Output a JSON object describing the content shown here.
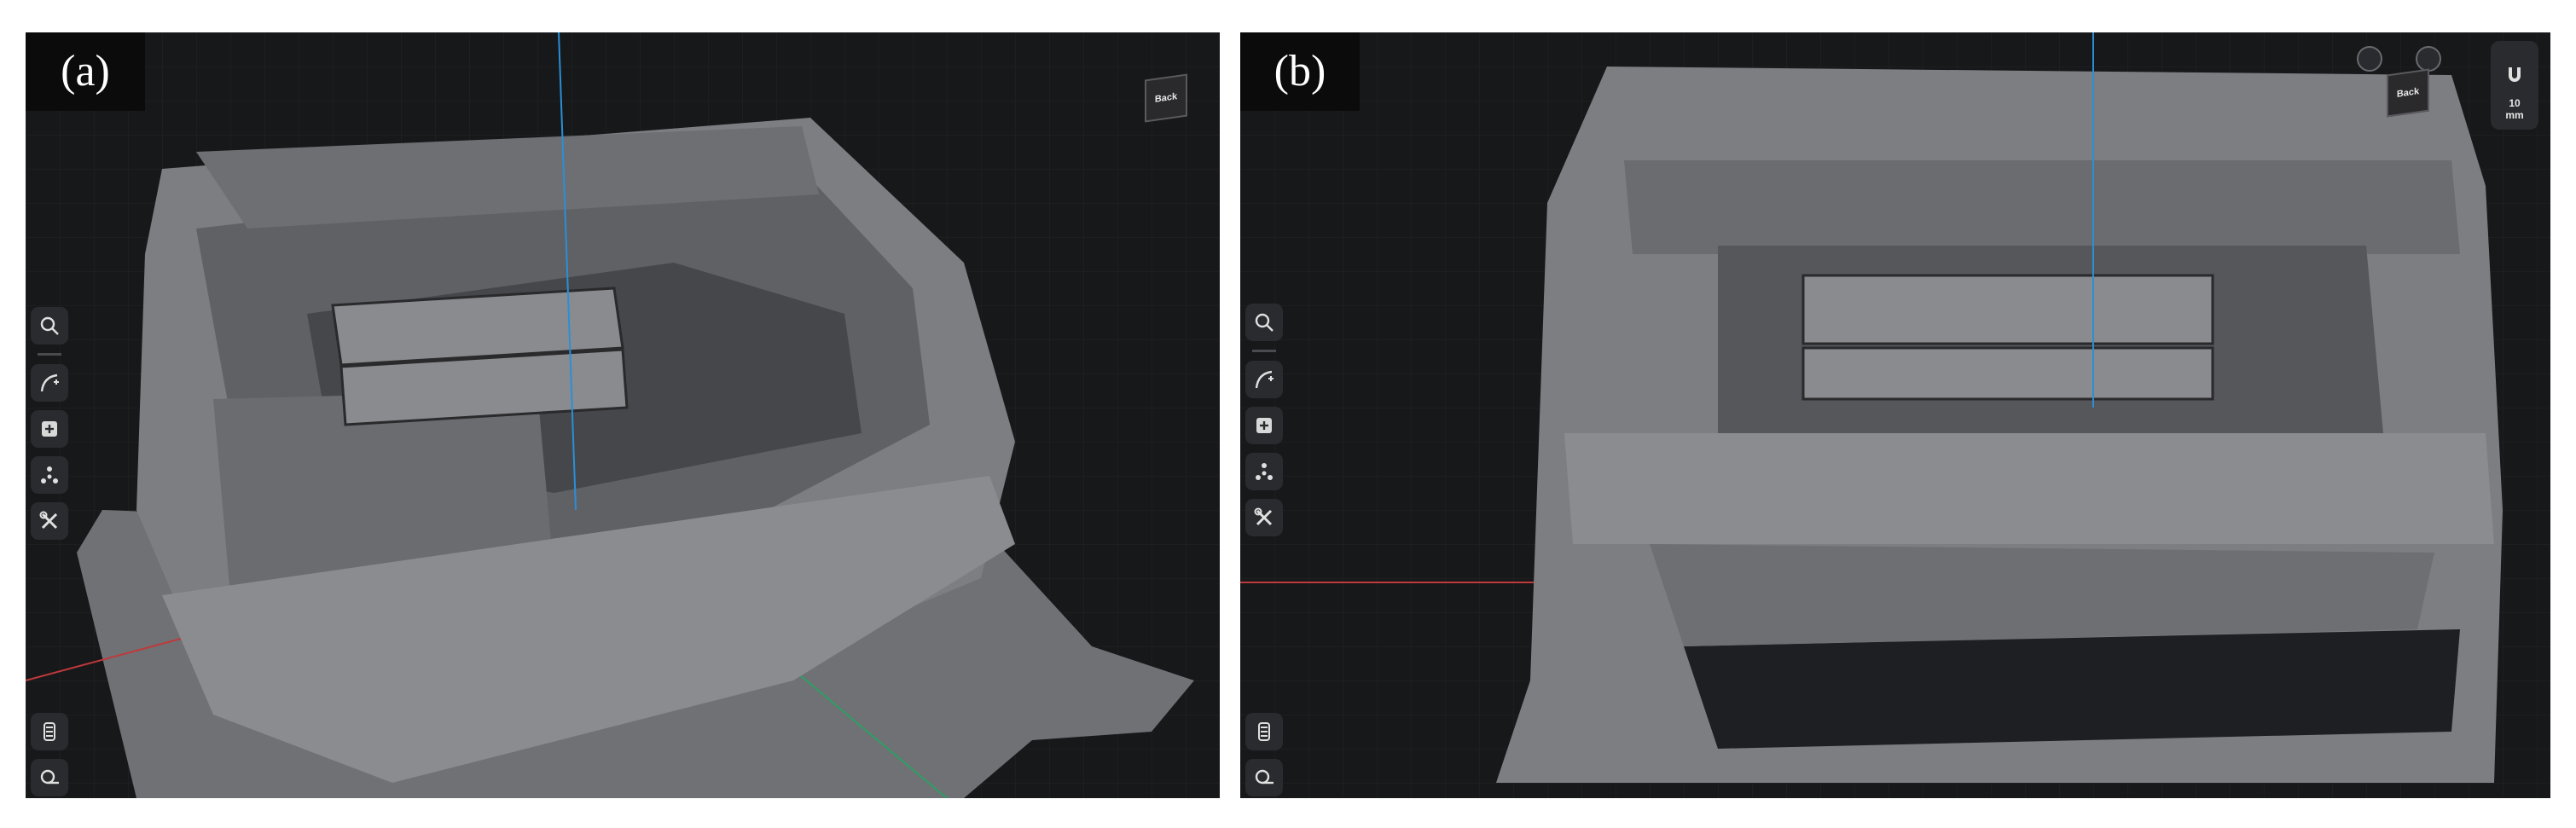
{
  "panels": [
    {
      "label": "(a)",
      "viewcube": {
        "face_label": "Back"
      },
      "toolbar": {
        "tools": [
          {
            "icon": "search-icon"
          },
          {
            "icon": "measure-curve-icon"
          },
          {
            "icon": "add-icon"
          },
          {
            "icon": "axis-gizmo-icon"
          },
          {
            "icon": "tools-icon"
          }
        ],
        "bottom": [
          {
            "icon": "layers-icon"
          },
          {
            "icon": "tape-measure-icon"
          }
        ]
      }
    },
    {
      "label": "(b)",
      "viewcube": {
        "face_label": "Back"
      },
      "snap": {
        "value": "10",
        "unit": "mm"
      },
      "toolbar": {
        "tools": [
          {
            "icon": "search-icon"
          },
          {
            "icon": "measure-curve-icon"
          },
          {
            "icon": "add-icon"
          },
          {
            "icon": "axis-gizmo-icon"
          },
          {
            "icon": "tools-icon"
          }
        ],
        "bottom": [
          {
            "icon": "layers-icon"
          },
          {
            "icon": "tape-measure-icon"
          }
        ]
      }
    }
  ],
  "colors": {
    "viewport_bg": "#17181a",
    "mesh": "#7c7e82",
    "box": "#8a8b8e",
    "axis_x": "#c0393b",
    "axis_y": "#2f9e64",
    "axis_z": "#2a8fd8"
  }
}
